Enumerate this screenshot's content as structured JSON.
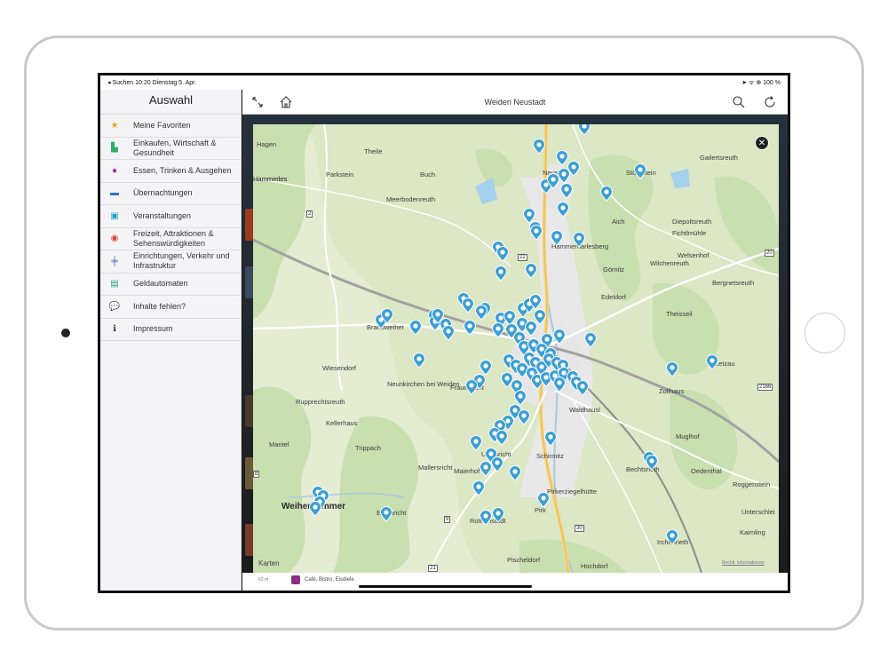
{
  "status": {
    "left": "◂ Suchen  10:20  Dienstag 5. Apr.",
    "right": "➤ ᯤ ⊕ 100 %"
  },
  "sidebar": {
    "title": "Auswahl",
    "items": [
      {
        "label": "Meine Favoriten",
        "icon": "star-icon",
        "color": "#f2a51c",
        "glyph": "★"
      },
      {
        "label": "Einkaufen, Wirtschaft & Gesundheit",
        "icon": "shopping-bag-icon",
        "color": "#2eae6a",
        "glyph": "▙"
      },
      {
        "label": "Essen, Trinken & Ausgehen",
        "icon": "dining-icon",
        "color": "#b3259a",
        "glyph": "●"
      },
      {
        "label": "Übernachtungen",
        "icon": "bed-icon",
        "color": "#2d73d9",
        "glyph": "▬"
      },
      {
        "label": "Veranstaltungen",
        "icon": "calendar-icon",
        "color": "#1fa3c7",
        "glyph": "▣"
      },
      {
        "label": "Freizeit, Attraktionen & Sehenswürdigkeiten",
        "icon": "eye-icon",
        "color": "#e23a3a",
        "glyph": "◉"
      },
      {
        "label": "Einrichtungen, Verkehr und Infrastruktur",
        "icon": "signpost-icon",
        "color": "#3d5fa8",
        "glyph": "╪"
      },
      {
        "label": "Geldautomaten",
        "icon": "atm-icon",
        "color": "#2ea27a",
        "glyph": "▤"
      },
      {
        "label": "Inhalte fehlen?",
        "icon": "chat-icon",
        "color": "#333333",
        "glyph": "💬"
      },
      {
        "label": "Impressum",
        "icon": "info-icon",
        "color": "#333333",
        "glyph": "ℹ"
      }
    ]
  },
  "topbar": {
    "title": "Weiden Neustadt"
  },
  "map": {
    "places": [
      {
        "name": "Hagen",
        "big": false
      },
      {
        "name": "Theile",
        "big": false
      },
      {
        "name": "Mallersricht",
        "big": false
      },
      {
        "name": "Parkstein",
        "big": false
      },
      {
        "name": "Buch",
        "big": false
      },
      {
        "name": "Hammerles",
        "big": false
      },
      {
        "name": "Meerbodenreuth",
        "big": false
      },
      {
        "name": "Neustadt",
        "big": false
      },
      {
        "name": "Störnstein",
        "big": false
      },
      {
        "name": "Gailertsreuth",
        "big": false
      },
      {
        "name": "Aich",
        "big": false
      },
      {
        "name": "Diepoltsreuth",
        "big": false
      },
      {
        "name": "Fichtlmühle",
        "big": false
      },
      {
        "name": "Hammerharlesberg",
        "big": false
      },
      {
        "name": "Welsenhof",
        "big": false
      },
      {
        "name": "Wilchenreuth",
        "big": false
      },
      {
        "name": "Görnitz",
        "big": false
      },
      {
        "name": "Bergnetsreuth",
        "big": false
      },
      {
        "name": "Edeldorf",
        "big": false
      },
      {
        "name": "Theisseil",
        "big": false
      },
      {
        "name": "Brandweiher",
        "big": false
      },
      {
        "name": "Wiesendorf",
        "big": false
      },
      {
        "name": "Neunkirchen bei Weiden",
        "big": false
      },
      {
        "name": "Rupprechtsreuth",
        "big": false
      },
      {
        "name": "Frauenricht",
        "big": false
      },
      {
        "name": "Zollhaus",
        "big": false
      },
      {
        "name": "Kellerhaus",
        "big": false
      },
      {
        "name": "Waldhausl",
        "big": false
      },
      {
        "name": "Letzau",
        "big": false
      },
      {
        "name": "Mantel",
        "big": false
      },
      {
        "name": "Trippach",
        "big": false
      },
      {
        "name": "Ullersricht",
        "big": false
      },
      {
        "name": "Schirmitz",
        "big": false
      },
      {
        "name": "Muglhof",
        "big": false
      },
      {
        "name": "Maierhof",
        "big": false
      },
      {
        "name": "Bechtsrieth",
        "big": false
      },
      {
        "name": "Oedenthal",
        "big": false
      },
      {
        "name": "Pirkerziegelhütte",
        "big": false
      },
      {
        "name": "Roggenstein",
        "big": false
      },
      {
        "name": "Weiherhammer",
        "big": true
      },
      {
        "name": "Etzenricht",
        "big": false
      },
      {
        "name": "Rothenstadt",
        "big": false
      },
      {
        "name": "Pirk",
        "big": false
      },
      {
        "name": "Unterschlei",
        "big": false
      },
      {
        "name": "Kaimling",
        "big": false
      },
      {
        "name": "Irchenrieth",
        "big": false
      },
      {
        "name": "Pischeldorf",
        "big": false
      },
      {
        "name": "Hochdorf",
        "big": false
      },
      {
        "name": "Hammerles",
        "big": false
      }
    ],
    "road_numbers": [
      "2",
      "22",
      "20",
      "2166",
      "9",
      "30",
      "21",
      "8"
    ],
    "attribution": " Karten",
    "legal": "Rechtl. Informationen",
    "close_glyph": "✕",
    "pin_color": "#3d9fd3"
  },
  "bottom": {
    "distance": "63 m",
    "text": "Café, Bistro, Eisdiele",
    "badge_color": "#8b2f83"
  }
}
